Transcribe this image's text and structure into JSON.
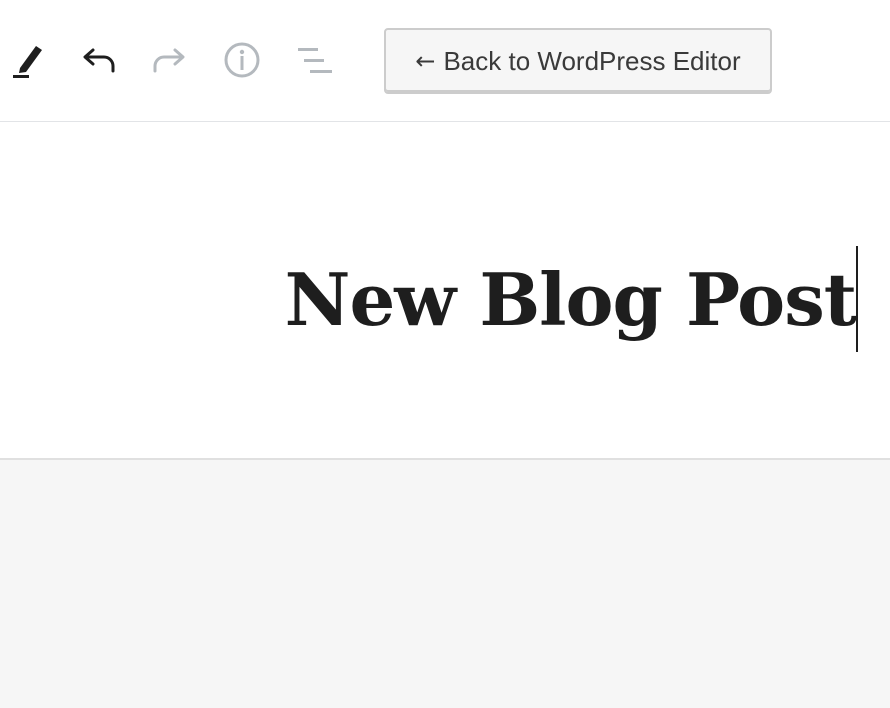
{
  "toolbar": {
    "tools": [
      {
        "icon": "pencil-icon",
        "label": "Tools",
        "enabled": true
      },
      {
        "icon": "undo-icon",
        "label": "Undo",
        "enabled": true
      },
      {
        "icon": "redo-icon",
        "label": "Redo",
        "enabled": false
      },
      {
        "icon": "info-icon",
        "label": "Content structure",
        "enabled": false
      },
      {
        "icon": "block-navigation-icon",
        "label": "Block navigation",
        "enabled": false
      }
    ],
    "back_button": {
      "arrow": "←",
      "label": "Back to WordPress Editor"
    }
  },
  "editor": {
    "title": "New Blog Post"
  },
  "colors": {
    "icon_active": "#1e1e1e",
    "icon_disabled": "#b4b9be",
    "canvas_background": "#f6f6f6"
  }
}
